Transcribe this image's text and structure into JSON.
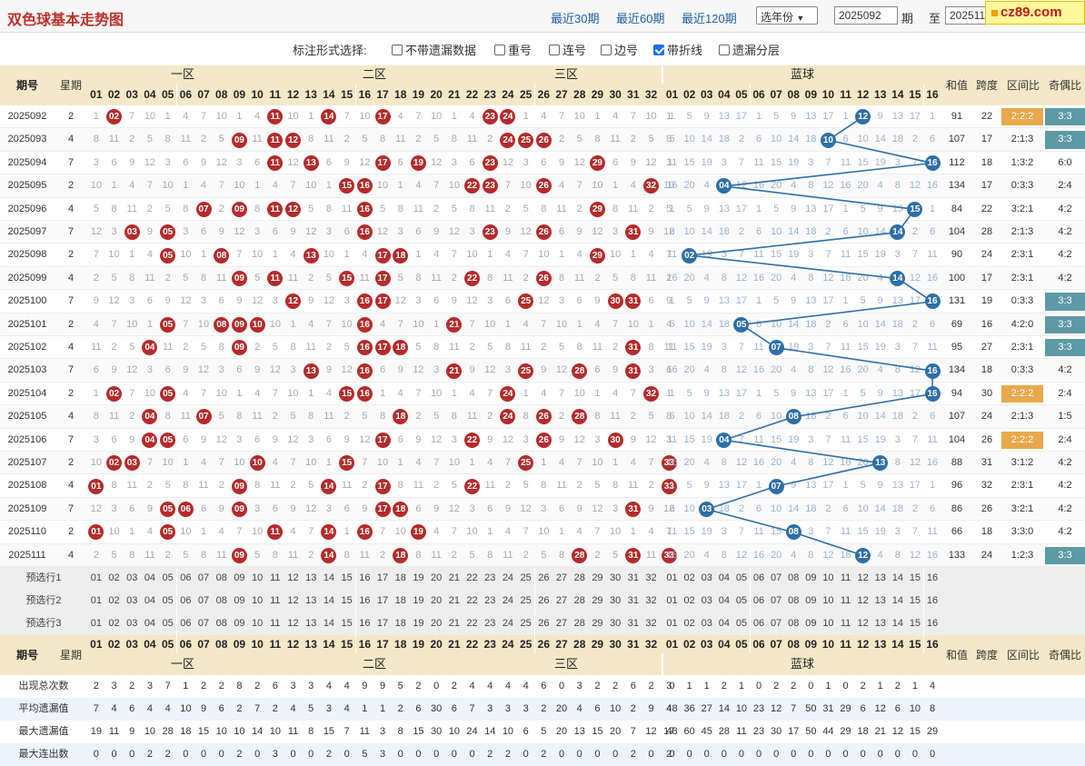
{
  "title": "双色球基本走势图",
  "badge": "cz89.com",
  "nav": {
    "r30": "最近30期",
    "r60": "最近60期",
    "r120": "最近120期",
    "year": "选年份",
    "from": "2025092",
    "period": "期",
    "to": "至",
    "to_val": "2025111",
    "search": "查询"
  },
  "opts": {
    "label": "标注形式选择:",
    "o1": "不带遗漏数据",
    "o2": "重号",
    "o3": "连号",
    "o4": "边号",
    "o5": "带折线",
    "o6": "遗漏分层"
  },
  "headers": {
    "issue": "期号",
    "week": "星期",
    "z1": "一区",
    "z2": "二区",
    "z3": "三区",
    "blue": "蓝球",
    "sum": "和值",
    "span": "跨度",
    "ratio": "区间比",
    "oe": "奇偶比"
  },
  "rows": [
    {
      "issue": "2025092",
      "week": "2",
      "reds": [
        2,
        11,
        14,
        17,
        23,
        24
      ],
      "blue": 12,
      "sum": "91",
      "span": "22",
      "ratio": "2:2:2",
      "oe": "3:3"
    },
    {
      "issue": "2025093",
      "week": "4",
      "reds": [
        9,
        11,
        12,
        24,
        25,
        26
      ],
      "blue": 10,
      "sum": "107",
      "span": "17",
      "ratio": "2:1:3",
      "oe": "3:3"
    },
    {
      "issue": "2025094",
      "week": "7",
      "reds": [
        11,
        13,
        17,
        19,
        23,
        29
      ],
      "blue": 16,
      "sum": "112",
      "span": "18",
      "ratio": "1:3:2",
      "oe": "6:0"
    },
    {
      "issue": "2025095",
      "week": "2",
      "reds": [
        15,
        16,
        22,
        23,
        26,
        32
      ],
      "blue": 4,
      "sum": "134",
      "span": "17",
      "ratio": "0:3:3",
      "oe": "2:4"
    },
    {
      "issue": "2025096",
      "week": "4",
      "reds": [
        7,
        9,
        11,
        12,
        16,
        29
      ],
      "blue": 15,
      "sum": "84",
      "span": "22",
      "ratio": "3:2:1",
      "oe": "4:2"
    },
    {
      "issue": "2025097",
      "week": "7",
      "reds": [
        3,
        5,
        16,
        23,
        26,
        31
      ],
      "blue": 14,
      "sum": "104",
      "span": "28",
      "ratio": "2:1:3",
      "oe": "4:2"
    },
    {
      "issue": "2025098",
      "week": "2",
      "reds": [
        5,
        8,
        13,
        17,
        18,
        29
      ],
      "blue": 2,
      "sum": "90",
      "span": "24",
      "ratio": "2:3:1",
      "oe": "4:2"
    },
    {
      "issue": "2025099",
      "week": "4",
      "reds": [
        9,
        11,
        15,
        17,
        22,
        26
      ],
      "blue": 14,
      "sum": "100",
      "span": "17",
      "ratio": "2:3:1",
      "oe": "4:2"
    },
    {
      "issue": "2025100",
      "week": "7",
      "reds": [
        12,
        16,
        17,
        25,
        30,
        31
      ],
      "blue": 16,
      "sum": "131",
      "span": "19",
      "ratio": "0:3:3",
      "oe": "3:3"
    },
    {
      "issue": "2025101",
      "week": "2",
      "reds": [
        5,
        8,
        9,
        10,
        16,
        21
      ],
      "blue": 5,
      "sum": "69",
      "span": "16",
      "ratio": "4:2:0",
      "oe": "3:3"
    },
    {
      "issue": "2025102",
      "week": "4",
      "reds": [
        4,
        9,
        16,
        17,
        18,
        31
      ],
      "blue": 7,
      "sum": "95",
      "span": "27",
      "ratio": "2:3:1",
      "oe": "3:3"
    },
    {
      "issue": "2025103",
      "week": "7",
      "reds": [
        13,
        16,
        21,
        25,
        28,
        31
      ],
      "blue": 16,
      "sum": "134",
      "span": "18",
      "ratio": "0:3:3",
      "oe": "4:2"
    },
    {
      "issue": "2025104",
      "week": "2",
      "reds": [
        2,
        5,
        15,
        16,
        24,
        32
      ],
      "blue": 16,
      "sum": "94",
      "span": "30",
      "ratio": "2:2:2",
      "oe": "2:4"
    },
    {
      "issue": "2025105",
      "week": "4",
      "reds": [
        4,
        7,
        18,
        24,
        26,
        28
      ],
      "blue": 8,
      "sum": "107",
      "span": "24",
      "ratio": "2:1:3",
      "oe": "1:5"
    },
    {
      "issue": "2025106",
      "week": "7",
      "reds": [
        4,
        5,
        17,
        22,
        26,
        30
      ],
      "blue": 4,
      "sum": "104",
      "span": "26",
      "ratio": "2:2:2",
      "oe": "2:4"
    },
    {
      "issue": "2025107",
      "week": "2",
      "reds": [
        2,
        3,
        10,
        15,
        25,
        33
      ],
      "blue": 13,
      "sum": "88",
      "span": "31",
      "ratio": "3:1:2",
      "oe": "4:2"
    },
    {
      "issue": "2025108",
      "week": "4",
      "reds": [
        1,
        9,
        14,
        17,
        22,
        33
      ],
      "blue": 7,
      "sum": "96",
      "span": "32",
      "ratio": "2:3:1",
      "oe": "4:2"
    },
    {
      "issue": "2025109",
      "week": "7",
      "reds": [
        5,
        6,
        9,
        17,
        18,
        31
      ],
      "blue": 3,
      "sum": "86",
      "span": "26",
      "ratio": "3:2:1",
      "oe": "4:2"
    },
    {
      "issue": "2025110",
      "week": "2",
      "reds": [
        1,
        5,
        11,
        14,
        16,
        19
      ],
      "blue": 8,
      "sum": "66",
      "span": "18",
      "ratio": "3:3:0",
      "oe": "4:2"
    },
    {
      "issue": "2025111",
      "week": "4",
      "reds": [
        9,
        14,
        18,
        28,
        31,
        33
      ],
      "blue": 12,
      "sum": "133",
      "span": "24",
      "ratio": "1:2:3",
      "oe": "3:3"
    }
  ],
  "pre_labels": [
    "预选行1",
    "预选行2",
    "预选行3"
  ],
  "stats": [
    {
      "label": "出现总次数",
      "red": [
        2,
        3,
        2,
        3,
        7,
        1,
        2,
        2,
        8,
        2,
        6,
        3,
        3,
        4,
        4,
        9,
        9,
        5,
        2,
        0,
        2,
        4,
        4,
        4,
        4,
        6,
        0,
        3,
        2,
        2,
        6,
        2,
        3
      ],
      "blue": [
        0,
        1,
        1,
        2,
        1,
        0,
        2,
        2,
        0,
        1,
        0,
        2,
        1,
        2,
        1,
        4
      ]
    },
    {
      "label": "平均遗漏值",
      "red": [
        7,
        4,
        6,
        4,
        4,
        10,
        9,
        6,
        2,
        7,
        2,
        4,
        5,
        3,
        4,
        1,
        1,
        2,
        6,
        30,
        6,
        7,
        3,
        3,
        3,
        2,
        20,
        4,
        6,
        10,
        2,
        9,
        4
      ],
      "blue": [
        48,
        36,
        27,
        14,
        10,
        23,
        12,
        7,
        50,
        31,
        29,
        6,
        12,
        6,
        10,
        8
      ]
    },
    {
      "label": "最大遗漏值",
      "red": [
        19,
        11,
        9,
        10,
        28,
        18,
        15,
        10,
        10,
        14,
        10,
        11,
        8,
        15,
        7,
        11,
        3,
        8,
        15,
        30,
        10,
        24,
        14,
        10,
        6,
        5,
        20,
        13,
        15,
        20,
        7,
        12,
        17
      ],
      "blue": [
        48,
        60,
        45,
        28,
        11,
        23,
        30,
        17,
        50,
        44,
        29,
        18,
        21,
        12,
        15,
        29
      ]
    },
    {
      "label": "最大连出数",
      "red": [
        0,
        0,
        0,
        2,
        2,
        0,
        0,
        0,
        2,
        0,
        3,
        0,
        0,
        2,
        0,
        5,
        3,
        0,
        0,
        0,
        0,
        0,
        2,
        2,
        0,
        2,
        0,
        0,
        0,
        0,
        2,
        0,
        2
      ],
      "blue": [
        0,
        0,
        0,
        0,
        0,
        0,
        0,
        0,
        0,
        0,
        0,
        0,
        0,
        0,
        0,
        0
      ]
    }
  ]
}
